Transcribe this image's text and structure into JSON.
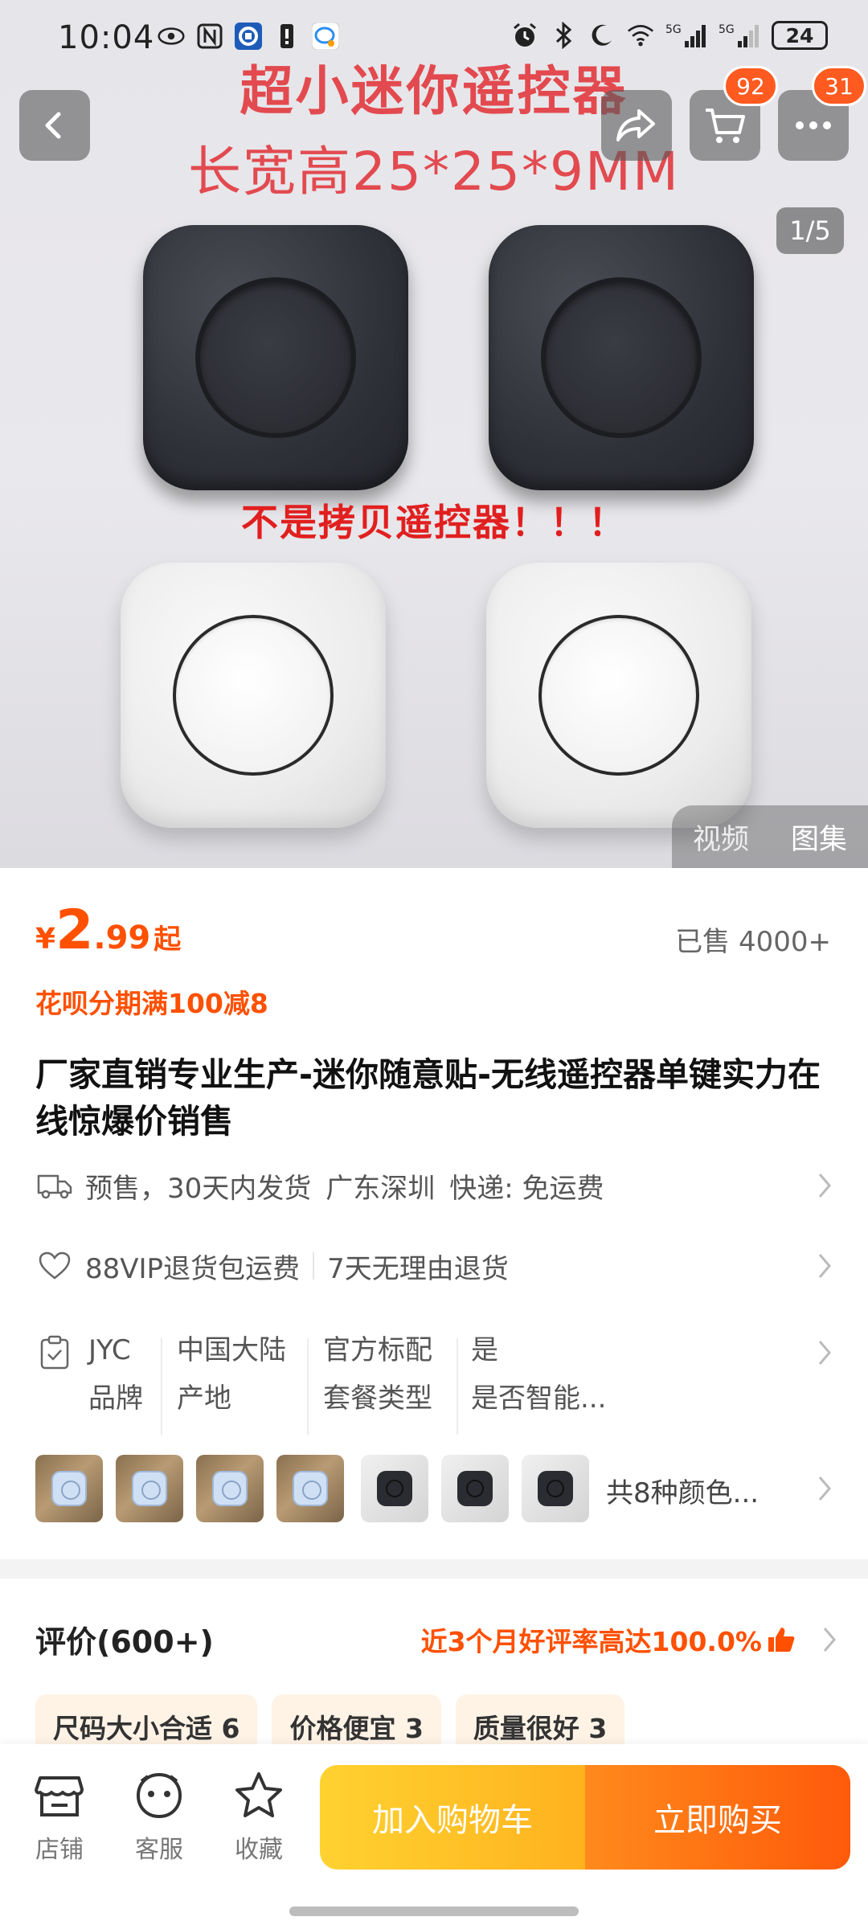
{
  "status_bar": {
    "time": "10:04",
    "net1": "5G",
    "net2": "5G",
    "battery": "24"
  },
  "hero": {
    "promo_line1": "超小迷你遥控器",
    "promo_line2": "长宽高25*25*9MM",
    "promo_mid": "不是拷贝遥控器！！！",
    "cart_badge": "92",
    "more_badge": "31",
    "counter": "1/5",
    "tabs": [
      "视频",
      "图集"
    ],
    "active_tab": "图集"
  },
  "product": {
    "price_currency": "¥",
    "price_int": "2",
    "price_dec": ".99",
    "price_suffix": "起",
    "sold": "已售 4000+",
    "installment": "花呗分期满100减8",
    "title": "厂家直销专业生产-迷你随意贴-无线遥控器单键实力在线惊爆价销售"
  },
  "shipping": {
    "presale": "预售，30天内发货",
    "origin": "广东深圳",
    "express": "快递: 免运费"
  },
  "service": {
    "vip": "88VIP退货包运费",
    "returns": "7天无理由退货"
  },
  "specs": [
    {
      "value": "JYC",
      "label": "品牌"
    },
    {
      "value": "中国大陆",
      "label": "产地"
    },
    {
      "value": "官方标配",
      "label": "套餐类型"
    },
    {
      "value": "是",
      "label": "是否智能..."
    }
  ],
  "colors": {
    "count_text": "共8种颜色...",
    "swatches": [
      "blue",
      "blue",
      "blue",
      "blue",
      "black",
      "black",
      "black"
    ]
  },
  "reviews": {
    "title": "评价(600+)",
    "rate": "近3个月好评率高达100.0%",
    "tags": [
      "尺码大小合适 6",
      "价格便宜 3",
      "质量很好 3"
    ]
  },
  "bottom_bar": {
    "shop": "店铺",
    "service": "客服",
    "favorite": "收藏",
    "add_to_cart": "加入购物车",
    "buy_now": "立即购买"
  },
  "colors_theme": {
    "accent": "#ff5000",
    "promo_red": "#e24a4f",
    "cart_yellow": "#ffc21f",
    "buy_orange": "#ff5a0a"
  }
}
